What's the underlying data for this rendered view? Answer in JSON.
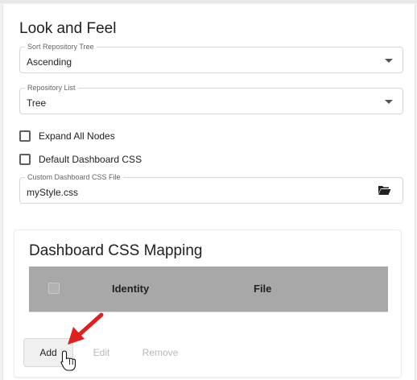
{
  "section": {
    "title": "Look and Feel",
    "sort_field": {
      "label": "Sort Repository Tree",
      "value": "Ascending"
    },
    "list_field": {
      "label": "Repository List",
      "value": "Tree"
    },
    "expand_all": {
      "label": "Expand All Nodes",
      "checked": false
    },
    "default_css": {
      "label": "Default Dashboard CSS",
      "checked": false
    },
    "css_file": {
      "label": "Custom Dashboard CSS File",
      "value": "myStyle.css"
    }
  },
  "mapping": {
    "title": "Dashboard CSS Mapping",
    "columns": [
      "Identity",
      "File"
    ],
    "buttons": {
      "add": "Add",
      "edit": "Edit",
      "remove": "Remove"
    }
  },
  "colors": {
    "accent_arrow": "#e02020",
    "grid_header": "#a8a8a8"
  },
  "icons": {
    "select_caret": "caret-down-icon",
    "file_browse": "folder-open-icon",
    "pointer": "hand-cursor-icon",
    "annotation": "red-arrow-icon"
  }
}
